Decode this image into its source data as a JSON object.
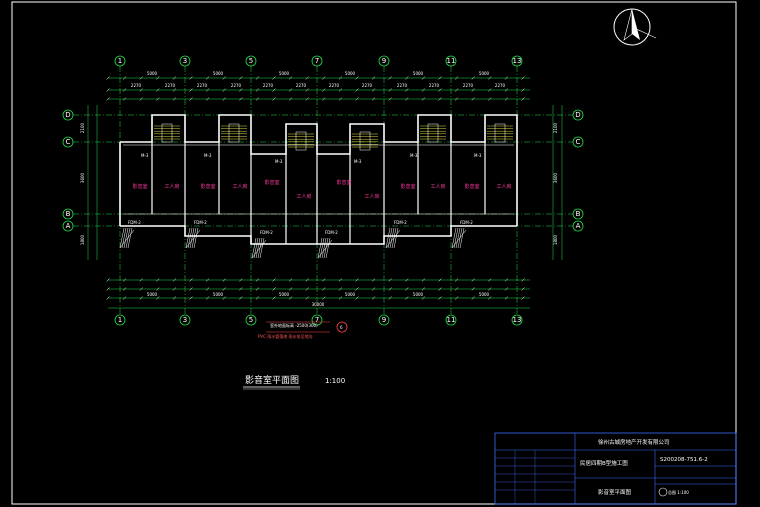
{
  "drawing": {
    "title": "影音室平面图",
    "scale": "1:100",
    "axes_top": [
      "1",
      "3",
      "5",
      "7",
      "9",
      "11",
      "13"
    ],
    "axes_bottom": [
      "1",
      "3",
      "5",
      "7",
      "9",
      "11",
      "13"
    ],
    "axes_left": [
      "D",
      "C",
      "B",
      "A"
    ],
    "axes_right": [
      "D",
      "C",
      "B",
      "A"
    ],
    "dims_top_overall": [
      "5000",
      "5000",
      "5000",
      "5000",
      "5000",
      "5000"
    ],
    "dims_top_detail": [
      "2270",
      "2270",
      "2270",
      "2270",
      "2270",
      "2270",
      "2270",
      "2270",
      "2270",
      "2270",
      "2270",
      "2270"
    ],
    "dims_bottom_overall": [
      "5000",
      "5000",
      "5000",
      "5000",
      "5000",
      "5000"
    ],
    "dims_total": "30000",
    "dims_left": [
      "2100",
      "3600",
      "1800"
    ],
    "dims_right": [
      "2100",
      "3600",
      "1800"
    ],
    "rooms": [
      {
        "label": "影音室",
        "color": "pink"
      },
      {
        "label": "工人房",
        "color": "pink"
      },
      {
        "label": "影音室",
        "color": "pink"
      },
      {
        "label": "工人房",
        "color": "pink"
      },
      {
        "label": "影音室",
        "color": "pink"
      },
      {
        "label": "工人房",
        "color": "pink"
      },
      {
        "label": "影音室",
        "color": "pink"
      },
      {
        "label": "工人房",
        "color": "pink"
      },
      {
        "label": "影音室",
        "color": "pink"
      },
      {
        "label": "工人房",
        "color": "pink"
      },
      {
        "label": "影音室",
        "color": "pink"
      },
      {
        "label": "工人房",
        "color": "pink"
      }
    ],
    "door_tags": [
      "M-3",
      "M-3",
      "M-3",
      "M-3",
      "M-3",
      "M-3"
    ],
    "window_tags": [
      "FDM-2",
      "FDM-2",
      "FDM-2",
      "FDM-2",
      "FDM-2",
      "FDM-2"
    ],
    "note_lines": [
      "室外地面标高 -2500(300)",
      "PVC 雨水管落地 雨水排至地沟"
    ],
    "note_marker": "6"
  },
  "title_block": {
    "company": "徐州古城房地产开发有限公司",
    "project": "民居四期B型施工图",
    "drawing_no": "S200208-751.6-2",
    "sheet_name": "影音室平面图",
    "stamp": "总图 1:100"
  },
  "colors": {
    "background": "#000000",
    "axis_green": "#22e04a",
    "wall_white": "#ffffff",
    "dim_green": "#22e04a",
    "room_text": "#ff3aa0",
    "frame_blue": "#3a6cff",
    "stair_yellow": "#e0e040"
  }
}
